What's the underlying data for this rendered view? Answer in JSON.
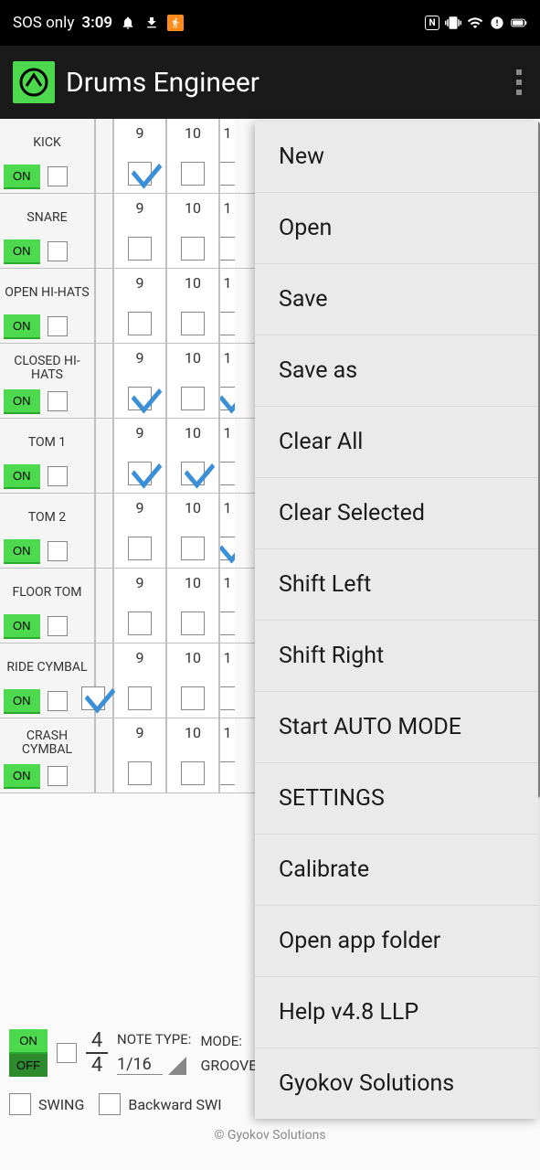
{
  "status_bar": {
    "signal": "SOS only",
    "time": "3:09"
  },
  "app": {
    "title": "Drums Engineer"
  },
  "tracks": [
    {
      "name": "KICK",
      "on": "ON",
      "steps": [
        {
          "n": "9",
          "c": true
        },
        {
          "n": "10",
          "c": false
        },
        {
          "n": "1",
          "c": false,
          "partial": true
        }
      ]
    },
    {
      "name": "SNARE",
      "on": "ON",
      "steps": [
        {
          "n": "9",
          "c": false
        },
        {
          "n": "10",
          "c": false
        },
        {
          "n": "1",
          "c": false,
          "partial": true
        }
      ]
    },
    {
      "name": "OPEN HI-HATS",
      "on": "ON",
      "steps": [
        {
          "n": "9",
          "c": false
        },
        {
          "n": "10",
          "c": false
        },
        {
          "n": "1",
          "c": false,
          "partial": true
        }
      ]
    },
    {
      "name": "CLOSED HI-HATS",
      "on": "ON",
      "steps": [
        {
          "n": "9",
          "c": true
        },
        {
          "n": "10",
          "c": false
        },
        {
          "n": "1",
          "c": true,
          "partial": true
        }
      ]
    },
    {
      "name": "TOM 1",
      "on": "ON",
      "steps": [
        {
          "n": "9",
          "c": true
        },
        {
          "n": "10",
          "c": true
        },
        {
          "n": "1",
          "c": false,
          "partial": true
        }
      ]
    },
    {
      "name": "TOM 2",
      "on": "ON",
      "steps": [
        {
          "n": "9",
          "c": false
        },
        {
          "n": "10",
          "c": false
        },
        {
          "n": "1",
          "c": true,
          "partial": true
        }
      ]
    },
    {
      "name": "FLOOR TOM",
      "on": "ON",
      "steps": [
        {
          "n": "9",
          "c": false
        },
        {
          "n": "10",
          "c": false
        },
        {
          "n": "1",
          "c": false,
          "partial": true
        }
      ]
    },
    {
      "name": "RIDE CYMBAL",
      "on": "ON",
      "steps": [
        {
          "n": "9",
          "c": false
        },
        {
          "n": "10",
          "c": false
        },
        {
          "n": "1",
          "c": false,
          "partial": true
        }
      ],
      "partial_check_left": true
    },
    {
      "name": "CRASH CYMBAL",
      "on": "ON",
      "steps": [
        {
          "n": "9",
          "c": false
        },
        {
          "n": "10",
          "c": false
        },
        {
          "n": "1",
          "c": false,
          "partial": true
        }
      ]
    }
  ],
  "bottom": {
    "on": "ON",
    "off": "OFF",
    "ts_num": "4",
    "ts_den": "4",
    "note_type_label": "NOTE TYPE:",
    "note_type_val": "1/16",
    "mode_label": "MODE:",
    "mode_val": "GROOVE",
    "swing": "SWING",
    "bswing": "Backward SWI"
  },
  "copyright": "© Gyokov Solutions",
  "menu": [
    "New",
    "Open",
    "Save",
    "Save as",
    "Clear All",
    "Clear Selected",
    "Shift Left",
    "Shift Right",
    "Start AUTO MODE",
    "SETTINGS",
    "Calibrate",
    "Open app folder",
    "Help v4.8 LLP",
    "Gyokov Solutions"
  ]
}
